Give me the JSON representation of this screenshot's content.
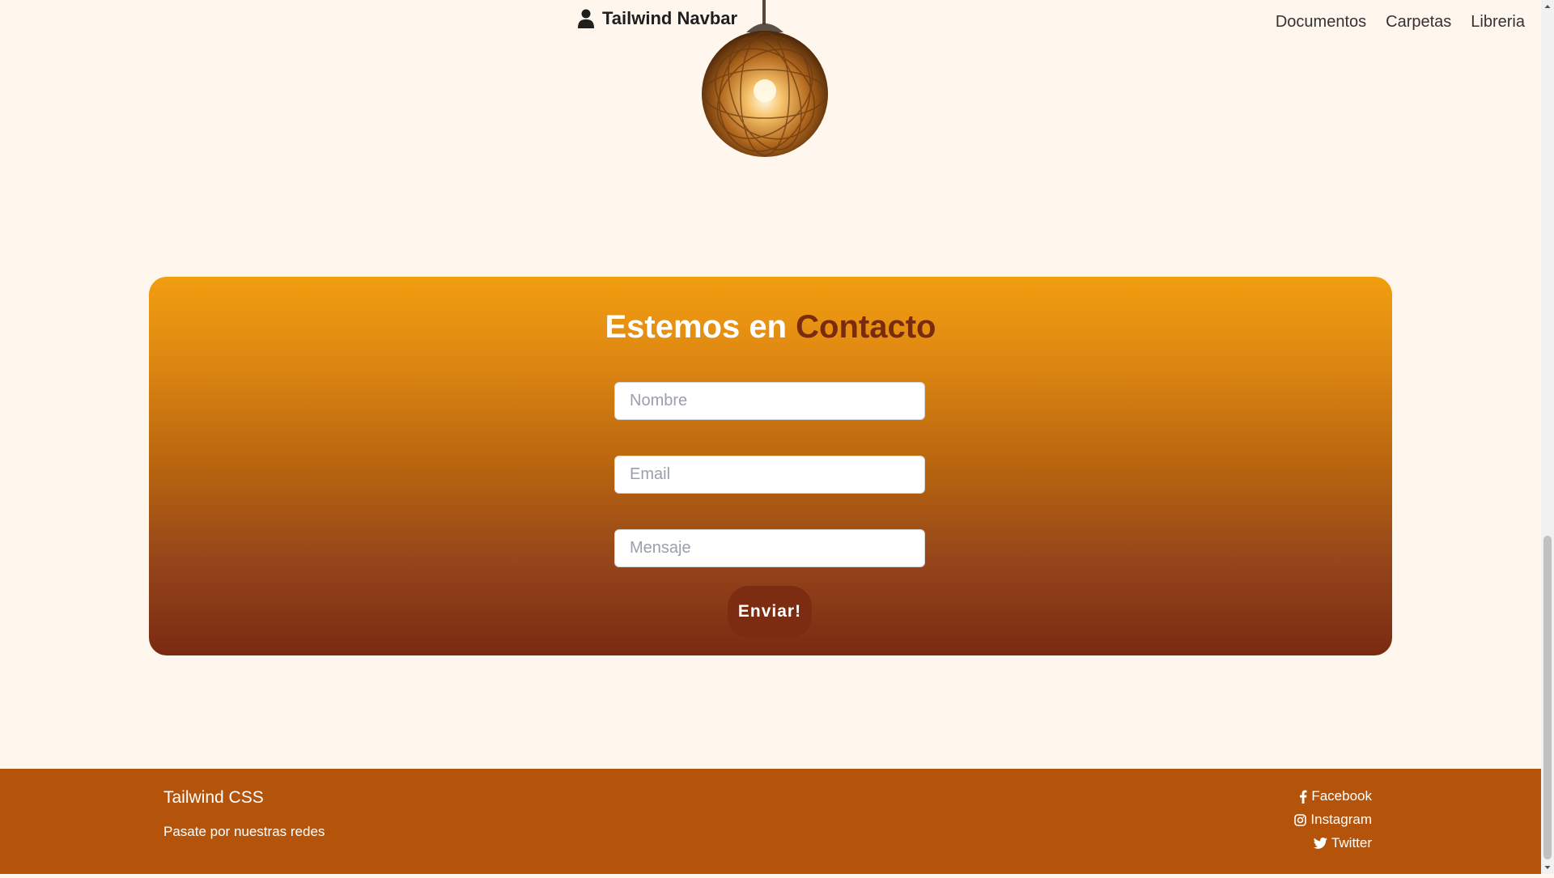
{
  "navbar": {
    "brand": "Tailwind Navbar",
    "brand_icon": "user-icon",
    "links": [
      "Documentos",
      "Carpetas",
      "Libreria"
    ]
  },
  "contact": {
    "title_part1": "Estemos en",
    "title_part2": "Contacto",
    "name_placeholder": "Nombre",
    "email_placeholder": "Email",
    "message_placeholder": "Mensaje",
    "submit_label": "Enviar!"
  },
  "footer": {
    "title": "Tailwind CSS",
    "subtitle": "Pasate por nuestras redes",
    "socials": [
      {
        "label": "Facebook",
        "icon": "facebook-icon"
      },
      {
        "label": "Instagram",
        "icon": "instagram-icon"
      },
      {
        "label": "Twitter",
        "icon": "twitter-icon"
      }
    ]
  },
  "colors": {
    "background": "#fff6ee",
    "card_gradient_top": "#f29e10",
    "card_gradient_bottom": "#7a2a12",
    "accent_text": "#7a2b0e",
    "button": "#7c2c10",
    "footer": "#b4540a"
  }
}
